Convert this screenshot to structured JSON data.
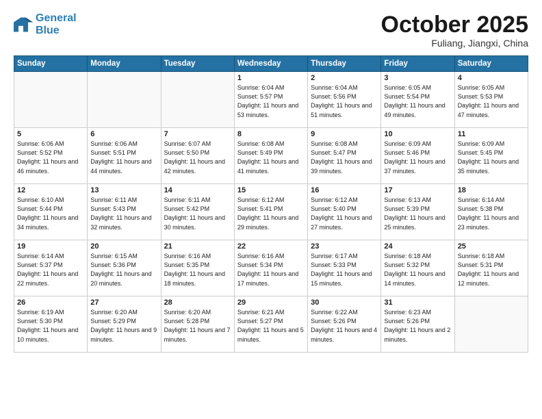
{
  "header": {
    "logo_line1": "General",
    "logo_line2": "Blue",
    "month_title": "October 2025",
    "location": "Fuliang, Jiangxi, China"
  },
  "weekdays": [
    "Sunday",
    "Monday",
    "Tuesday",
    "Wednesday",
    "Thursday",
    "Friday",
    "Saturday"
  ],
  "weeks": [
    [
      {
        "day": "",
        "text": ""
      },
      {
        "day": "",
        "text": ""
      },
      {
        "day": "",
        "text": ""
      },
      {
        "day": "1",
        "text": "Sunrise: 6:04 AM\nSunset: 5:57 PM\nDaylight: 11 hours and 53 minutes."
      },
      {
        "day": "2",
        "text": "Sunrise: 6:04 AM\nSunset: 5:56 PM\nDaylight: 11 hours and 51 minutes."
      },
      {
        "day": "3",
        "text": "Sunrise: 6:05 AM\nSunset: 5:54 PM\nDaylight: 11 hours and 49 minutes."
      },
      {
        "day": "4",
        "text": "Sunrise: 6:05 AM\nSunset: 5:53 PM\nDaylight: 11 hours and 47 minutes."
      }
    ],
    [
      {
        "day": "5",
        "text": "Sunrise: 6:06 AM\nSunset: 5:52 PM\nDaylight: 11 hours and 46 minutes."
      },
      {
        "day": "6",
        "text": "Sunrise: 6:06 AM\nSunset: 5:51 PM\nDaylight: 11 hours and 44 minutes."
      },
      {
        "day": "7",
        "text": "Sunrise: 6:07 AM\nSunset: 5:50 PM\nDaylight: 11 hours and 42 minutes."
      },
      {
        "day": "8",
        "text": "Sunrise: 6:08 AM\nSunset: 5:49 PM\nDaylight: 11 hours and 41 minutes."
      },
      {
        "day": "9",
        "text": "Sunrise: 6:08 AM\nSunset: 5:47 PM\nDaylight: 11 hours and 39 minutes."
      },
      {
        "day": "10",
        "text": "Sunrise: 6:09 AM\nSunset: 5:46 PM\nDaylight: 11 hours and 37 minutes."
      },
      {
        "day": "11",
        "text": "Sunrise: 6:09 AM\nSunset: 5:45 PM\nDaylight: 11 hours and 35 minutes."
      }
    ],
    [
      {
        "day": "12",
        "text": "Sunrise: 6:10 AM\nSunset: 5:44 PM\nDaylight: 11 hours and 34 minutes."
      },
      {
        "day": "13",
        "text": "Sunrise: 6:11 AM\nSunset: 5:43 PM\nDaylight: 11 hours and 32 minutes."
      },
      {
        "day": "14",
        "text": "Sunrise: 6:11 AM\nSunset: 5:42 PM\nDaylight: 11 hours and 30 minutes."
      },
      {
        "day": "15",
        "text": "Sunrise: 6:12 AM\nSunset: 5:41 PM\nDaylight: 11 hours and 29 minutes."
      },
      {
        "day": "16",
        "text": "Sunrise: 6:12 AM\nSunset: 5:40 PM\nDaylight: 11 hours and 27 minutes."
      },
      {
        "day": "17",
        "text": "Sunrise: 6:13 AM\nSunset: 5:39 PM\nDaylight: 11 hours and 25 minutes."
      },
      {
        "day": "18",
        "text": "Sunrise: 6:14 AM\nSunset: 5:38 PM\nDaylight: 11 hours and 23 minutes."
      }
    ],
    [
      {
        "day": "19",
        "text": "Sunrise: 6:14 AM\nSunset: 5:37 PM\nDaylight: 11 hours and 22 minutes."
      },
      {
        "day": "20",
        "text": "Sunrise: 6:15 AM\nSunset: 5:36 PM\nDaylight: 11 hours and 20 minutes."
      },
      {
        "day": "21",
        "text": "Sunrise: 6:16 AM\nSunset: 5:35 PM\nDaylight: 11 hours and 18 minutes."
      },
      {
        "day": "22",
        "text": "Sunrise: 6:16 AM\nSunset: 5:34 PM\nDaylight: 11 hours and 17 minutes."
      },
      {
        "day": "23",
        "text": "Sunrise: 6:17 AM\nSunset: 5:33 PM\nDaylight: 11 hours and 15 minutes."
      },
      {
        "day": "24",
        "text": "Sunrise: 6:18 AM\nSunset: 5:32 PM\nDaylight: 11 hours and 14 minutes."
      },
      {
        "day": "25",
        "text": "Sunrise: 6:18 AM\nSunset: 5:31 PM\nDaylight: 11 hours and 12 minutes."
      }
    ],
    [
      {
        "day": "26",
        "text": "Sunrise: 6:19 AM\nSunset: 5:30 PM\nDaylight: 11 hours and 10 minutes."
      },
      {
        "day": "27",
        "text": "Sunrise: 6:20 AM\nSunset: 5:29 PM\nDaylight: 11 hours and 9 minutes."
      },
      {
        "day": "28",
        "text": "Sunrise: 6:20 AM\nSunset: 5:28 PM\nDaylight: 11 hours and 7 minutes."
      },
      {
        "day": "29",
        "text": "Sunrise: 6:21 AM\nSunset: 5:27 PM\nDaylight: 11 hours and 5 minutes."
      },
      {
        "day": "30",
        "text": "Sunrise: 6:22 AM\nSunset: 5:26 PM\nDaylight: 11 hours and 4 minutes."
      },
      {
        "day": "31",
        "text": "Sunrise: 6:23 AM\nSunset: 5:26 PM\nDaylight: 11 hours and 2 minutes."
      },
      {
        "day": "",
        "text": ""
      }
    ]
  ]
}
